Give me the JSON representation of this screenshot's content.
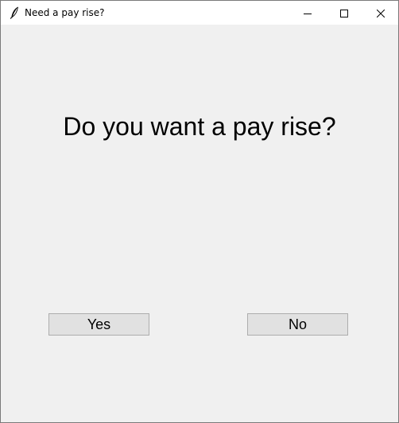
{
  "window": {
    "title": "Need a pay rise?",
    "icon": "feather-icon",
    "controls": [
      "minimize-icon",
      "maximize-icon",
      "close-icon"
    ]
  },
  "main": {
    "question": "Do you want a pay rise?",
    "yes_label": "Yes",
    "no_label": "No"
  },
  "colors": {
    "background": "#f0f0f0",
    "titlebar": "#ffffff",
    "button_face": "#e1e1e1",
    "button_border": "#adadad"
  }
}
